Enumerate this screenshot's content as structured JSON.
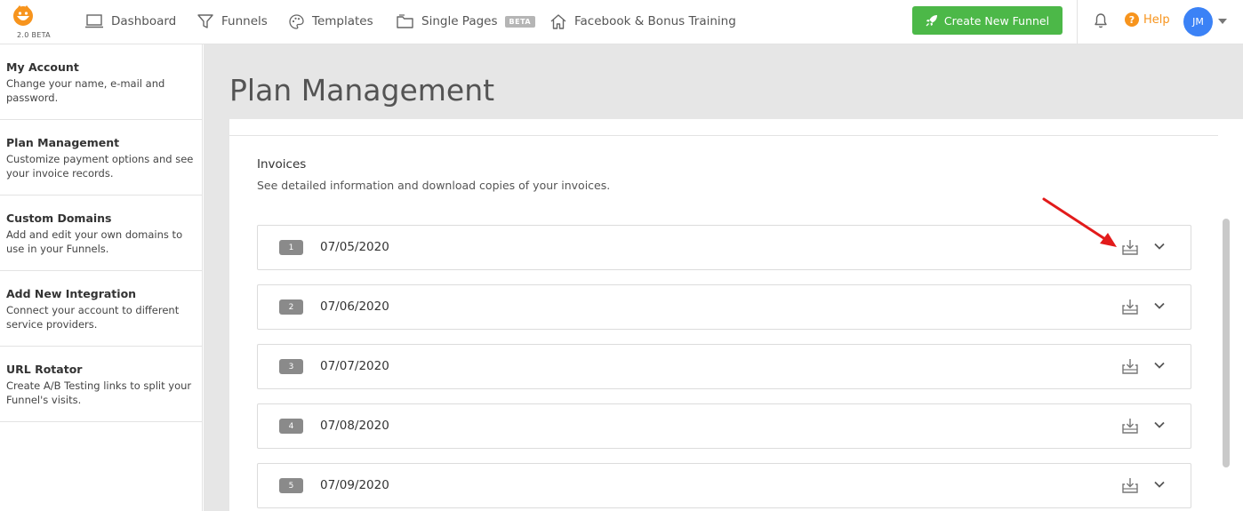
{
  "app": {
    "logo_label": "2.0 BETA",
    "brand_color": "#f7941d"
  },
  "nav": {
    "items": [
      {
        "label": "Dashboard",
        "icon": "laptop-icon"
      },
      {
        "label": "Funnels",
        "icon": "funnel-icon"
      },
      {
        "label": "Templates",
        "icon": "palette-icon"
      },
      {
        "label": "Single Pages",
        "icon": "folder-icon",
        "badge": "BETA"
      },
      {
        "label": "Facebook & Bonus Training",
        "icon": "home-icon"
      }
    ],
    "create_button": "Create New Funnel",
    "create_button_color": "#4cb848",
    "help_label": "Help",
    "avatar_initials": "JM"
  },
  "sidebar": {
    "items": [
      {
        "title": "My Account",
        "desc": "Change your name, e-mail and password."
      },
      {
        "title": "Plan Management",
        "desc": "Customize payment options and see your invoice records."
      },
      {
        "title": "Custom Domains",
        "desc": "Add and edit your own domains to use in your Funnels."
      },
      {
        "title": "Add New Integration",
        "desc": "Connect your account to different service providers."
      },
      {
        "title": "URL Rotator",
        "desc": "Create A/B Testing links to split your Funnel's visits."
      }
    ]
  },
  "main": {
    "page_title": "Plan Management",
    "invoices_title": "Invoices",
    "invoices_subtitle": "See detailed information and download copies of your invoices.",
    "invoices": [
      {
        "number": "1",
        "date": "07/05/2020"
      },
      {
        "number": "2",
        "date": "07/06/2020"
      },
      {
        "number": "3",
        "date": "07/07/2020"
      },
      {
        "number": "4",
        "date": "07/08/2020"
      },
      {
        "number": "5",
        "date": "07/09/2020"
      }
    ]
  }
}
